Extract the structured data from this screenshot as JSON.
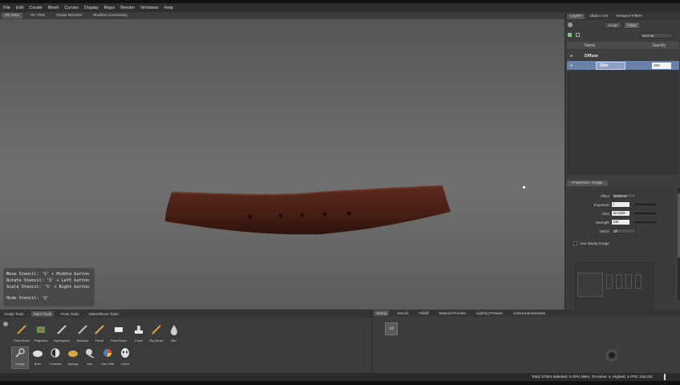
{
  "menu": [
    "File",
    "Edit",
    "Create",
    "Mesh",
    "Curves",
    "Display",
    "Maps",
    "Render",
    "Windows",
    "Help"
  ],
  "view_tabs": [
    "3D View",
    "UV View",
    "Image Browser",
    "Mudbox Community"
  ],
  "stencil_help": {
    "move": "Move Stencil: 'S' + Middle button",
    "rotate": "Rotate Stencil: 'S' + Left button",
    "scale": "Scale Stencil: 'S' + Right button",
    "hide": "Hide Stencil: 'Q'"
  },
  "right_panel": {
    "tabs": [
      "Layers",
      "Object List",
      "Viewport Filters"
    ],
    "mode_sculpt": "Sculpt",
    "mode_paint": "Paint",
    "blend_mode": "Normal",
    "col_name": "Name",
    "col_opacity": "Opacity",
    "group_name": "Diffuse",
    "layer_name": "Skin",
    "layer_opacity": "100"
  },
  "properties": {
    "title": "Properties: Dodge",
    "affect_label": "Affect",
    "affect_value": "Midtones",
    "exposure_label": "Exposure",
    "exposure_value": "1",
    "size_label": "Size",
    "size_value": "16.5306",
    "strength_label": "Strength",
    "strength_value": "100",
    "mirror_label": "Mirror",
    "mirror_value": "off",
    "use_stamp_label": "Use Stamp Image"
  },
  "tool_tabs": [
    "Sculpt Tools",
    "Paint Tools",
    "Pose Tools",
    "Select/Move Tools"
  ],
  "paint_tools_row1": [
    "Paint Brush",
    "Projection",
    "Eyedropper",
    "Airbrush",
    "Pencil",
    "Paint Erase",
    "Clone",
    "Dry Brush",
    "Blur"
  ],
  "paint_tools_row2": [
    "Dodge",
    "Burn",
    "Contrast",
    "Sponge",
    "Hue",
    "Hue Shift",
    "Invert"
  ],
  "stamp_tabs": [
    "Stamp",
    "Stencil",
    "Falloff",
    "Material Presets",
    "Lighting Presets",
    "Camera Bookmarks"
  ],
  "stamp_off": "Off",
  "status": "Total: 57344  Selected: 0  GPU Mem: 78  Active: 4, Highest: 4  FPS: 249.222"
}
